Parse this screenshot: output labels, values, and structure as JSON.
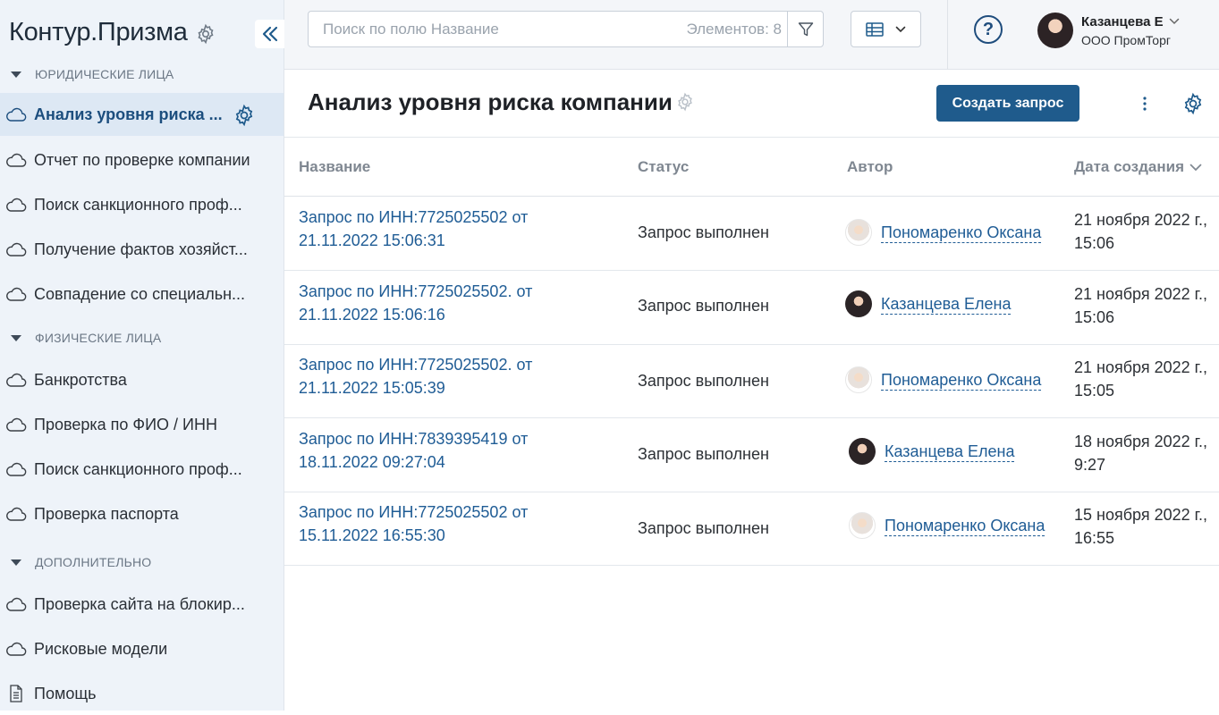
{
  "app": {
    "title": "Контур.Призма",
    "collapse_icon": "double-chevron-left-icon"
  },
  "sidebar": {
    "sections": [
      {
        "label": "ЮРИДИЧЕСКИЕ ЛИЦА"
      },
      {
        "label": "ФИЗИЧЕСКИЕ ЛИЦА"
      },
      {
        "label": "ДОПОЛНИТЕЛЬНО"
      }
    ],
    "items": [
      {
        "label": "Анализ уровня риска ...",
        "icon": "cloud-icon",
        "active": true
      },
      {
        "label": "Отчет по проверке компании",
        "icon": "cloud-icon"
      },
      {
        "label": "Поиск санкционного проф...",
        "icon": "cloud-icon"
      },
      {
        "label": "Получение фактов хозяйст...",
        "icon": "cloud-icon"
      },
      {
        "label": "Совпадение со специальн...",
        "icon": "cloud-icon"
      },
      {
        "label": "Банкротства",
        "icon": "cloud-icon"
      },
      {
        "label": "Проверка по ФИО / ИНН",
        "icon": "cloud-icon"
      },
      {
        "label": "Поиск санкционного проф...",
        "icon": "cloud-icon"
      },
      {
        "label": "Проверка паспорта",
        "icon": "cloud-icon"
      },
      {
        "label": "Проверка сайта на блокир...",
        "icon": "cloud-icon"
      },
      {
        "label": "Рисковые модели",
        "icon": "cloud-icon"
      },
      {
        "label": "Помощь",
        "icon": "document-icon"
      }
    ]
  },
  "topbar": {
    "search_placeholder": "Поиск по полю Название",
    "count_text": "Элементов: 8",
    "user": {
      "name": "Казанцева Е",
      "org": "ООО ПромТорг"
    }
  },
  "page": {
    "title": "Анализ уровня риска компании",
    "create_button": "Создать запрос"
  },
  "colors": {
    "accent": "#1f5b8c",
    "link": "#1f5c95",
    "sidebar_bg": "#eef3f9",
    "active_item_bg": "#dde8f4"
  },
  "table": {
    "columns": [
      "Название",
      "Статус",
      "Автор",
      "Дата создания"
    ],
    "rows": [
      {
        "name": "Запрос по ИНН:7725025502 от 21.11.2022 15:06:31",
        "status": "Запрос выполнен",
        "author": "Пономаренко Оксана",
        "date": "21 ноября 2022 г., 15:06"
      },
      {
        "name": "Запрос по ИНН:7725025502. от 21.11.2022 15:06:16",
        "status": "Запрос выполнен",
        "author": "Казанцева Елена",
        "date": "21 ноября 2022 г., 15:06"
      },
      {
        "name": "Запрос по ИНН:7725025502. от 21.11.2022 15:05:39",
        "status": "Запрос выполнен",
        "author": "Пономаренко Оксана",
        "date": "21 ноября 2022 г., 15:05"
      },
      {
        "name": "Запрос по ИНН:7839395419 от 18.11.2022 09:27:04",
        "status": "Запрос выполнен",
        "author": "Казанцева Елена",
        "date": "18 ноября 2022 г., 9:27"
      },
      {
        "name": "Запрос по ИНН:7725025502 от 15.11.2022 16:55:30",
        "status": "Запрос выполнен",
        "author": "Пономаренко Оксана",
        "date": "15 ноября 2022 г., 16:55"
      }
    ]
  }
}
